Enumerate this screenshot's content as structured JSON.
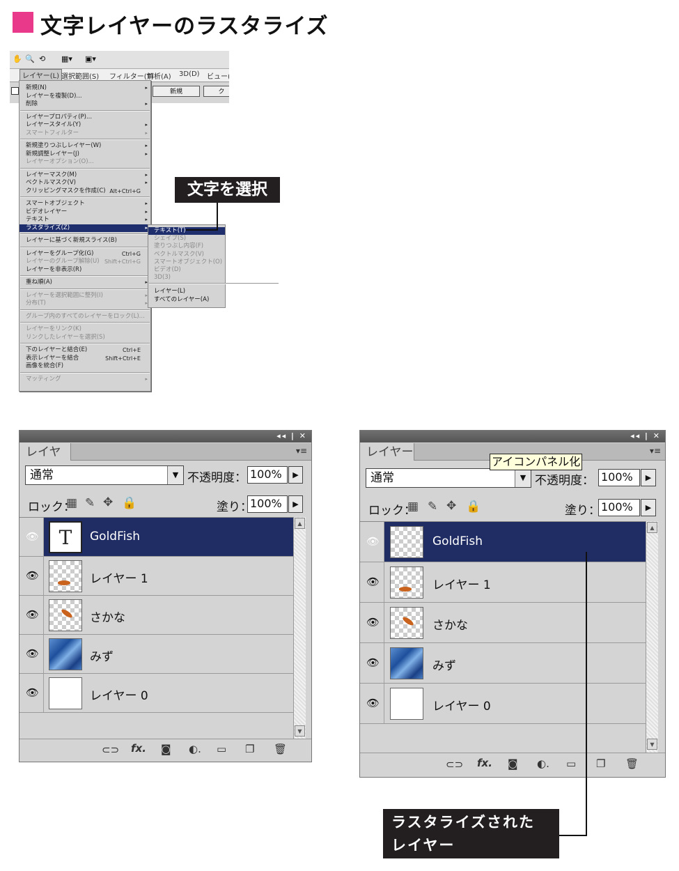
{
  "title": "文字レイヤーのラスタライズ",
  "accent_color": "#e8398a",
  "menu_screenshot": {
    "menubar": [
      "レイヤー(L)",
      "選択範囲(S)",
      "フィルター(T)",
      "解析(A)",
      "3D(D)",
      "ビュー(V)"
    ],
    "option_buttons": [
      "新規",
      "ク"
    ],
    "menu_items": [
      {
        "label": "新規(N)",
        "arrow": true
      },
      {
        "label": "レイヤーを複製(D)..."
      },
      {
        "label": "削除",
        "arrow": true
      },
      {
        "sep": true
      },
      {
        "label": "レイヤープロパティ(P)..."
      },
      {
        "label": "レイヤースタイル(Y)",
        "arrow": true
      },
      {
        "label": "スマートフィルター",
        "arrow": true,
        "disabled": true
      },
      {
        "sep": true
      },
      {
        "label": "新規塗りつぶしレイヤー(W)",
        "arrow": true
      },
      {
        "label": "新規調整レイヤー(J)",
        "arrow": true
      },
      {
        "label": "レイヤーオプション(O)...",
        "disabled": true
      },
      {
        "sep": true
      },
      {
        "label": "レイヤーマスク(M)",
        "arrow": true
      },
      {
        "label": "ベクトルマスク(V)",
        "arrow": true
      },
      {
        "label": "クリッピングマスクを作成(C)",
        "shortcut": "Alt+Ctrl+G"
      },
      {
        "sep": true
      },
      {
        "label": "スマートオブジェクト",
        "arrow": true
      },
      {
        "label": "ビデオレイヤー",
        "arrow": true
      },
      {
        "label": "テキスト",
        "arrow": true
      },
      {
        "label": "ラスタライズ(Z)",
        "arrow": true,
        "selected": true
      },
      {
        "sep": true
      },
      {
        "label": "レイヤーに基づく新規スライス(B)"
      },
      {
        "sep": true
      },
      {
        "label": "レイヤーをグループ化(G)",
        "shortcut": "Ctrl+G"
      },
      {
        "label": "レイヤーのグループ解除(U)",
        "shortcut": "Shift+Ctrl+G",
        "disabled": true
      },
      {
        "label": "レイヤーを非表示(R)"
      },
      {
        "sep": true
      },
      {
        "label": "重ね順(A)",
        "arrow": true
      },
      {
        "sep": true
      },
      {
        "label": "レイヤーを選択範囲に整列(I)",
        "arrow": true,
        "disabled": true
      },
      {
        "label": "分布(T)",
        "arrow": true,
        "disabled": true
      },
      {
        "sep": true
      },
      {
        "label": "グループ内のすべてのレイヤーをロック(L)...",
        "disabled": true
      },
      {
        "sep": true
      },
      {
        "label": "レイヤーをリンク(K)",
        "disabled": true
      },
      {
        "label": "リンクしたレイヤーを選択(S)",
        "disabled": true
      },
      {
        "sep": true
      },
      {
        "label": "下のレイヤーと結合(E)",
        "shortcut": "Ctrl+E"
      },
      {
        "label": "表示レイヤーを結合",
        "shortcut": "Shift+Ctrl+E"
      },
      {
        "label": "画像を統合(F)"
      },
      {
        "sep": true
      },
      {
        "label": "マッティング",
        "arrow": true,
        "disabled": true
      }
    ],
    "submenu_items": [
      {
        "label": "テキスト(T)",
        "selected": true
      },
      {
        "label": "シェイプ(S)",
        "disabled": true
      },
      {
        "label": "塗りつぶし内容(F)",
        "disabled": true
      },
      {
        "label": "ベクトルマスク(V)",
        "disabled": true
      },
      {
        "label": "スマートオブジェクト(O)",
        "disabled": true
      },
      {
        "label": "ビデオ(D)",
        "disabled": true
      },
      {
        "label": "3D(3)",
        "disabled": true
      },
      {
        "sep": true
      },
      {
        "label": "レイヤー(L)"
      },
      {
        "label": "すべてのレイヤー(A)"
      }
    ]
  },
  "callout_select_text": "文字を選択",
  "panel_common": {
    "tab_label": "レイヤー",
    "blend_mode": "通常",
    "opacity_label": "不透明度：",
    "opacity_value": "100%",
    "lock_label": "ロック：",
    "fill_label": "塗り：",
    "fill_value": "100%"
  },
  "panel_before": {
    "layers": [
      {
        "name": "GoldFish",
        "thumb": "text",
        "selected": true
      },
      {
        "name": "レイヤー 1",
        "thumb": "fish-small"
      },
      {
        "name": "さかな",
        "thumb": "fish"
      },
      {
        "name": "みず",
        "thumb": "water"
      },
      {
        "name": "レイヤー 0",
        "thumb": "white"
      }
    ]
  },
  "panel_after": {
    "tooltip": "アイコンパネル化",
    "layers": [
      {
        "name": "GoldFish",
        "thumb": "checker",
        "selected": true
      },
      {
        "name": "レイヤー 1",
        "thumb": "fish-small"
      },
      {
        "name": "さかな",
        "thumb": "fish"
      },
      {
        "name": "みず",
        "thumb": "water"
      },
      {
        "name": "レイヤー 0",
        "thumb": "white"
      }
    ]
  },
  "callout_rasterized": [
    "ラスタライズされた",
    "レイヤー"
  ]
}
